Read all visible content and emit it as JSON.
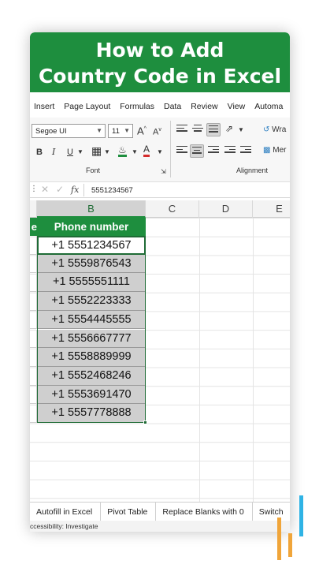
{
  "title": {
    "line1": "How to Add",
    "line2": "Country Code in Excel"
  },
  "menu": [
    "Insert",
    "Page Layout",
    "Formulas",
    "Data",
    "Review",
    "View",
    "Automa"
  ],
  "ribbon": {
    "font_name": "Segoe UI",
    "font_size": "11",
    "font_group_label": "Font",
    "alignment_group_label": "Alignment",
    "wrap_label": "Wra",
    "merge_label": "Mer",
    "bold": "B",
    "italic": "I",
    "underline": "U",
    "grow_font": "A",
    "shrink_font": "A",
    "font_color": "A"
  },
  "formula_bar": {
    "value": "5551234567",
    "fx": "fx"
  },
  "columns": [
    "B",
    "C",
    "D",
    "E"
  ],
  "grid": {
    "header_partial": "e",
    "header": "Phone number",
    "values": [
      "+1 5551234567",
      "+1 5559876543",
      "+1 5555551111",
      "+1 5552223333",
      "+1 5554445555",
      "+1 5556667777",
      "+1 5558889999",
      "+1 5552468246",
      "+1 5553691470",
      "+1 5557778888"
    ]
  },
  "sheet_tabs": [
    "Autofill in Excel",
    "Pivot Table",
    "Replace Blanks with 0",
    "Switch"
  ],
  "status_bar": "ccessibility: Investigate",
  "colors": {
    "brand_green": "#1e8e3e",
    "accent_orange": "#f0a53a",
    "accent_blue": "#2fb3e5"
  }
}
